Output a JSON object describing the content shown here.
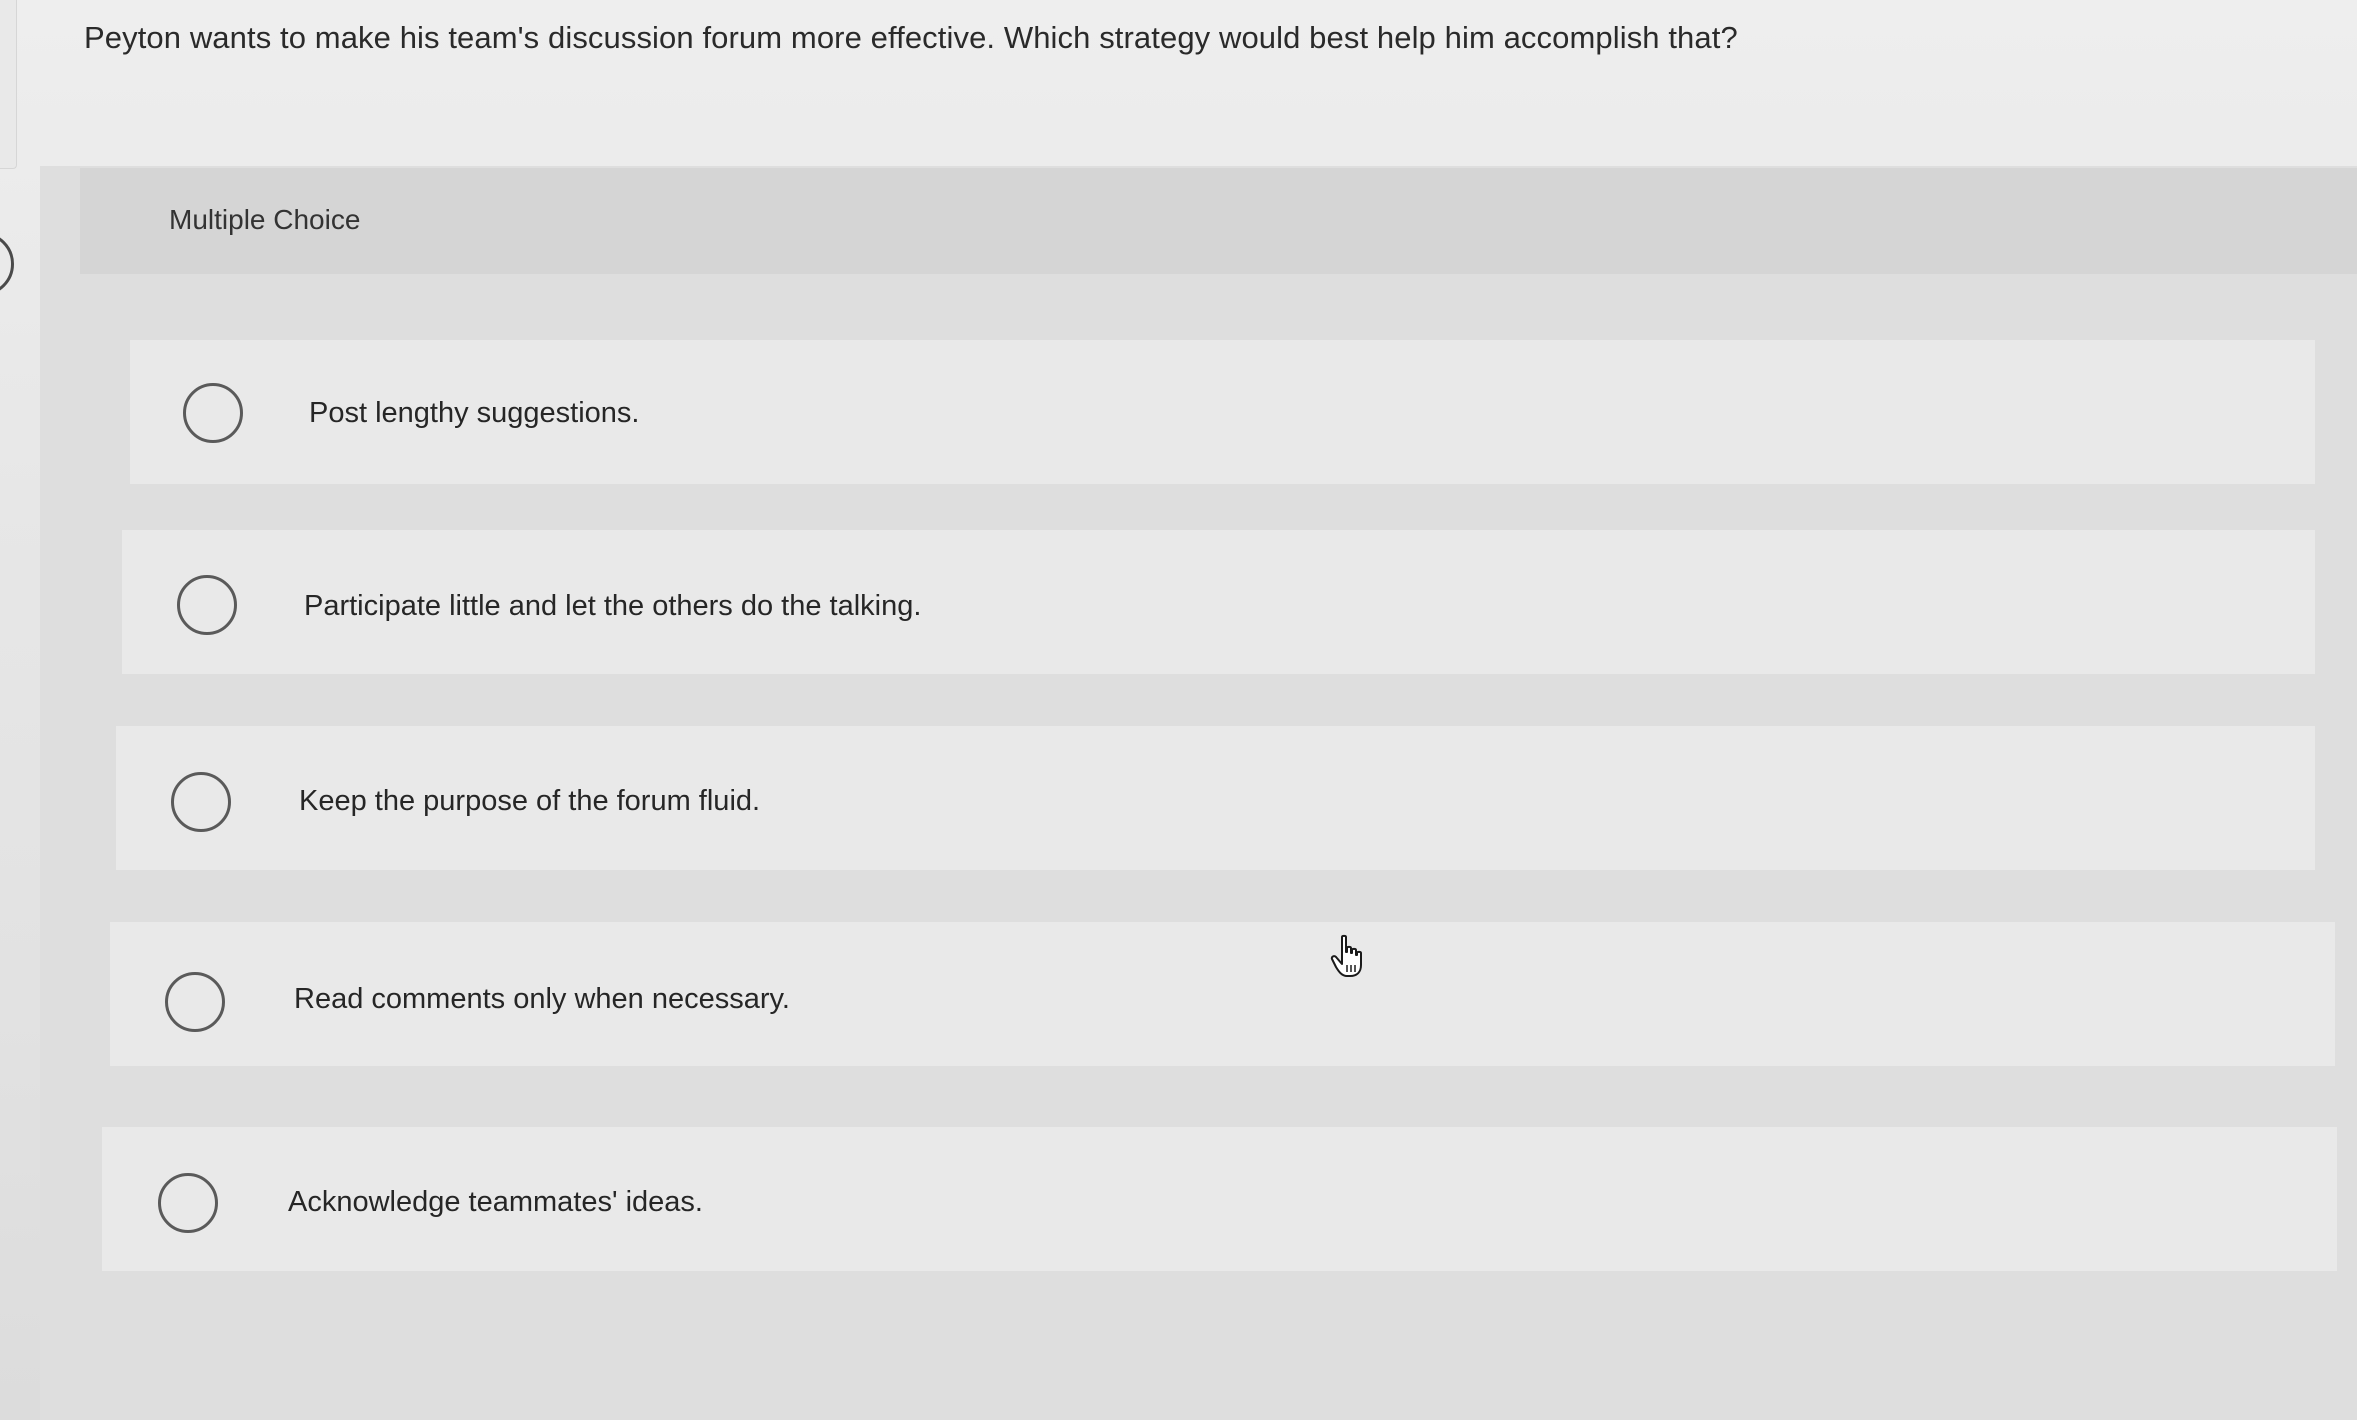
{
  "question": {
    "text": "Peyton wants to make his team's discussion forum more effective. Which strategy would best help him accomplish that?"
  },
  "section": {
    "label": "Multiple Choice"
  },
  "options": [
    {
      "label": "Post lengthy suggestions.",
      "selected": false
    },
    {
      "label": "Participate little and let the others do the talking.",
      "selected": false
    },
    {
      "label": "Keep the purpose of the forum fluid.",
      "selected": false
    },
    {
      "label": "Read comments only when necessary.",
      "selected": false
    },
    {
      "label": "Acknowledge teammates' ideas.",
      "selected": false
    }
  ],
  "icons": {
    "radio": "radio-button-icon",
    "cursor": "hand-pointer-icon"
  },
  "colors": {
    "background": "#e6e6e6",
    "option_background": "#e9e9e9",
    "header_background": "#d5d5d5",
    "radio_border": "#5a5a5a"
  }
}
